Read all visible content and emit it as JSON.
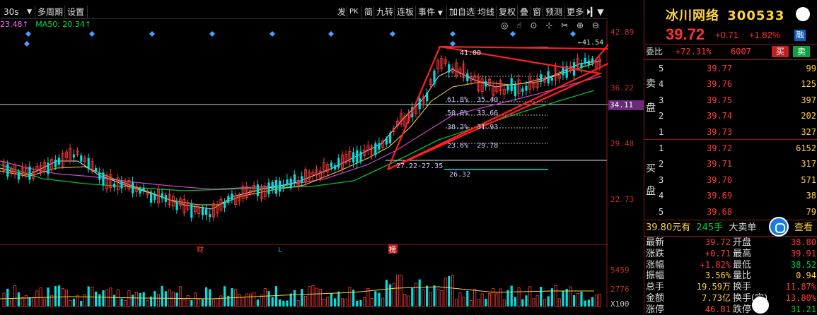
{
  "top_menu_partial": [
    "...",
    "...",
    "...",
    "...",
    "..."
  ],
  "toolbar": {
    "period": "30s",
    "items_left": [
      "多周期",
      "设置"
    ],
    "items_right": [
      "发",
      "PK",
      "简",
      "九转",
      "连板",
      "事件",
      "加自选",
      "均线",
      "复权",
      "叠",
      "窗",
      "预测",
      "更多"
    ]
  },
  "indicators": {
    "ma_partial": "23.48↑",
    "ma50": "MA50: 20.34↑"
  },
  "tool_icons": "◎ ☝ ⊙ ⊹ ✂ ⊕ ⊖",
  "axis": {
    "labels": [
      "42.89",
      "36.22",
      "29.48",
      "22.73"
    ],
    "marker_price": "34.11",
    "vol_labels": [
      "5459",
      "2776",
      "X100"
    ]
  },
  "annotations": {
    "high": "41.54",
    "high_short": "41.00",
    "low_range": "27.22-27.35",
    "fib": [
      {
        "pct": "61.8%",
        "price": "35.40"
      },
      {
        "pct": "50.0%",
        "price": "33.66"
      },
      {
        "pct": "38.2%",
        "price": "31.93"
      },
      {
        "pct": "23.6%",
        "price": "29.78"
      }
    ],
    "fib_low": "26.32",
    "event_markers": [
      "财",
      "L",
      "榜"
    ]
  },
  "stock": {
    "name": "冰川网络",
    "code": "300533",
    "price": "39.72",
    "change": "+0.71",
    "change_pct": "+1.82%",
    "badge": "融"
  },
  "weibi": {
    "label": "委比",
    "value": "+72.31%",
    "diff": "6007",
    "sell_btn": "买",
    "buy_btn": "卖"
  },
  "sell_side_label": [
    "卖",
    "盘"
  ],
  "buy_side_label": [
    "买",
    "盘"
  ],
  "sell_orders": [
    {
      "level": "5",
      "price": "39.77",
      "vol": "99"
    },
    {
      "level": "4",
      "price": "39.76",
      "vol": "125"
    },
    {
      "level": "3",
      "price": "39.75",
      "vol": "397"
    },
    {
      "level": "2",
      "price": "39.74",
      "vol": "202"
    },
    {
      "level": "1",
      "price": "39.73",
      "vol": "327"
    }
  ],
  "buy_orders": [
    {
      "level": "1",
      "price": "39.72",
      "vol": "6152"
    },
    {
      "level": "2",
      "price": "39.71",
      "vol": "317"
    },
    {
      "level": "3",
      "price": "39.70",
      "vol": "571"
    },
    {
      "level": "4",
      "price": "39.69",
      "vol": "38"
    },
    {
      "level": "5",
      "price": "39.68",
      "vol": "79"
    }
  ],
  "big_order": {
    "price": "39.80元有",
    "qty": "245手",
    "label": "大卖单",
    "link": "查看"
  },
  "stats": [
    {
      "l1": "最新",
      "v1": "39.72",
      "l2": "开盘",
      "v2": "38.80"
    },
    {
      "l1": "涨跌",
      "v1": "+0.71",
      "l2": "最高",
      "v2": "39.91"
    },
    {
      "l1": "涨幅",
      "v1": "+1.82%",
      "l2": "最低",
      "v2": "38.52"
    },
    {
      "l1": "振幅",
      "v1": "3.56%",
      "l2": "量比",
      "v2": "0.94"
    },
    {
      "l1": "总手",
      "v1": "19.59万",
      "l2": "换手",
      "v2": "11.87%"
    },
    {
      "l1": "金额",
      "v1": "7.73亿",
      "l2": "换手(实)",
      "v2": "13.80%"
    },
    {
      "l1": "涨停",
      "v1": "46.81",
      "l2": "跌停",
      "v2": "31.21"
    }
  ],
  "bottom_tabs": "...",
  "colors": {
    "up": "#ff3b3b",
    "down": "#00e0e0",
    "accent": "#ffd23e",
    "annot": "#ff2020"
  }
}
